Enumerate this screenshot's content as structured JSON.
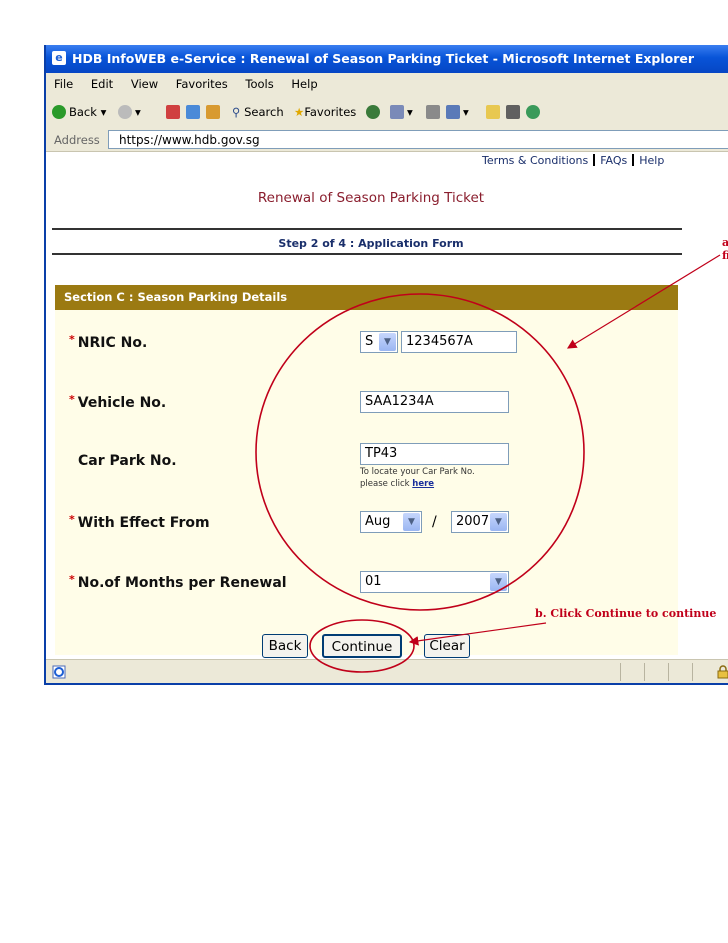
{
  "window": {
    "title": "HDB InfoWEB e-Service : Renewal of Season Parking Ticket - Microsoft Internet Explorer"
  },
  "menu": [
    "File",
    "Edit",
    "View",
    "Favorites",
    "Tools",
    "Help"
  ],
  "toolbar": {
    "back": "Back",
    "search": "Search",
    "favorites": "Favorites"
  },
  "address": {
    "label": "Address",
    "url": "https://www.hdb.gov.sg"
  },
  "top_links": {
    "terms": "Terms & Conditions",
    "faqs": "FAQs",
    "help": "Help"
  },
  "page": {
    "title": "Renewal of Season Parking Ticket",
    "step": "Step 2 of 4 : Application Form",
    "section": "Section C : Season Parking Details"
  },
  "form": {
    "nric_label": "NRIC No.",
    "nric_prefix": "S",
    "nric_value": "1234567A",
    "vehicle_label": "Vehicle No.",
    "vehicle_value": "SAA1234A",
    "carpark_label": "Car Park No.",
    "carpark_value": "TP43",
    "carpark_hint_1": "To locate your Car Park No.",
    "carpark_hint_2": "please click",
    "carpark_hint_link": "here",
    "effect_label": "With Effect From",
    "effect_month": "Aug",
    "effect_sep": "/",
    "effect_year": "2007",
    "months_label": "No.of Months per Renewal",
    "months_value": "01"
  },
  "buttons": {
    "back": "Back",
    "continue": "Continue",
    "clear": "Clear"
  },
  "annotations": {
    "a_line1": "a",
    "a_line2": "fi",
    "b": "b. Click Continue to continue"
  },
  "colors": {
    "annotation": "#c0001a",
    "section_bar": "#9b7a12",
    "title_bar": "#0854d8"
  }
}
